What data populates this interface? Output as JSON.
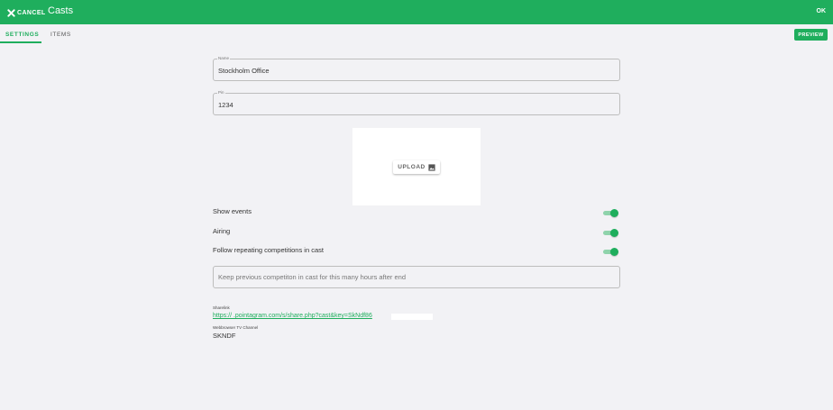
{
  "header": {
    "cancel_label": "CANCEL",
    "title": "Casts",
    "ok_label": "OK",
    "color": "#1fae5d"
  },
  "tabs": [
    {
      "label": "SETTINGS",
      "active": true
    },
    {
      "label": "ITEMS",
      "active": false
    }
  ],
  "preview_label": "PREVIEW",
  "form": {
    "name": {
      "label": "Name",
      "value": "Stockholm Office"
    },
    "pin": {
      "label": "Pin",
      "value": "1234"
    },
    "upload_label": "UPLOAD",
    "toggles": [
      {
        "label": "Show events",
        "on": true
      },
      {
        "label": "Airing",
        "on": true
      },
      {
        "label": "Follow repeating competitions in cast",
        "on": true
      }
    ],
    "hours_placeholder": "Keep previous competiton in cast for this many hours after end"
  },
  "sharelink": {
    "label": "Sharelink",
    "url": "https://          .pointagram.com/s/share.php?cast&key=SkNdf86"
  },
  "webbrowser_channel": {
    "label": "Webbrowser TV Channel",
    "value": "SKNDF"
  },
  "icons": {
    "cancel": "close-icon",
    "upload": "image-icon"
  }
}
